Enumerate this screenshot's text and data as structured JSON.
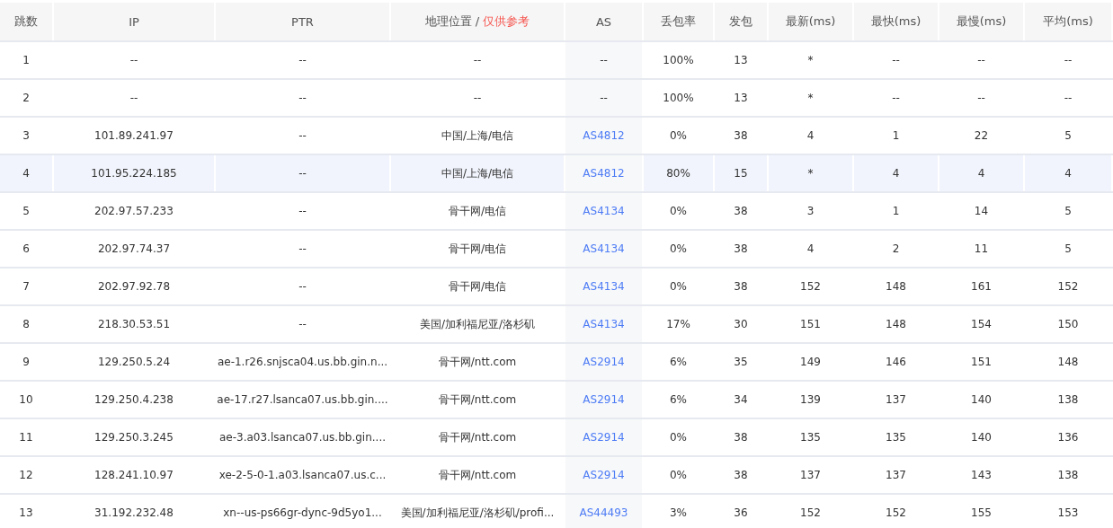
{
  "table": {
    "columns": [
      {
        "label": "跳数"
      },
      {
        "label": "IP"
      },
      {
        "label": "PTR"
      },
      {
        "label": "地理位置 /",
        "note": "仅供参考"
      },
      {
        "label": "AS"
      },
      {
        "label": "丢包率"
      },
      {
        "label": "发包"
      },
      {
        "label": "最新(ms)"
      },
      {
        "label": "最快(ms)"
      },
      {
        "label": "最慢(ms)"
      },
      {
        "label": "平均(ms)"
      }
    ],
    "rows": [
      {
        "selected": false,
        "hop": "1",
        "ip": "--",
        "ptr": "--",
        "geo": "--",
        "as": "--",
        "loss": "100%",
        "sent": "13",
        "last": "*",
        "best": "--",
        "worst": "--",
        "avg": "--"
      },
      {
        "selected": false,
        "hop": "2",
        "ip": "--",
        "ptr": "--",
        "geo": "--",
        "as": "--",
        "loss": "100%",
        "sent": "13",
        "last": "*",
        "best": "--",
        "worst": "--",
        "avg": "--"
      },
      {
        "selected": false,
        "hop": "3",
        "ip": "101.89.241.97",
        "ptr": "--",
        "geo": "中国/上海/电信",
        "as": "AS4812",
        "loss": "0%",
        "sent": "38",
        "last": "4",
        "best": "1",
        "worst": "22",
        "avg": "5"
      },
      {
        "selected": true,
        "hop": "4",
        "ip": "101.95.224.185",
        "ptr": "--",
        "geo": "中国/上海/电信",
        "as": "AS4812",
        "loss": "80%",
        "sent": "15",
        "last": "*",
        "best": "4",
        "worst": "4",
        "avg": "4"
      },
      {
        "selected": false,
        "hop": "5",
        "ip": "202.97.57.233",
        "ptr": "--",
        "geo": "骨干网/电信",
        "as": "AS4134",
        "loss": "0%",
        "sent": "38",
        "last": "3",
        "best": "1",
        "worst": "14",
        "avg": "5"
      },
      {
        "selected": false,
        "hop": "6",
        "ip": "202.97.74.37",
        "ptr": "--",
        "geo": "骨干网/电信",
        "as": "AS4134",
        "loss": "0%",
        "sent": "38",
        "last": "4",
        "best": "2",
        "worst": "11",
        "avg": "5"
      },
      {
        "selected": false,
        "hop": "7",
        "ip": "202.97.92.78",
        "ptr": "--",
        "geo": "骨干网/电信",
        "as": "AS4134",
        "loss": "0%",
        "sent": "38",
        "last": "152",
        "best": "148",
        "worst": "161",
        "avg": "152"
      },
      {
        "selected": false,
        "hop": "8",
        "ip": "218.30.53.51",
        "ptr": "--",
        "geo": "美国/加利福尼亚/洛杉矶",
        "as": "AS4134",
        "loss": "17%",
        "sent": "30",
        "last": "151",
        "best": "148",
        "worst": "154",
        "avg": "150"
      },
      {
        "selected": false,
        "hop": "9",
        "ip": "129.250.5.24",
        "ptr": "ae-1.r26.snjsca04.us.bb.gin.n...",
        "geo": "骨干网/ntt.com",
        "as": "AS2914",
        "loss": "6%",
        "sent": "35",
        "last": "149",
        "best": "146",
        "worst": "151",
        "avg": "148"
      },
      {
        "selected": false,
        "hop": "10",
        "ip": "129.250.4.238",
        "ptr": "ae-17.r27.lsanca07.us.bb.gin....",
        "geo": "骨干网/ntt.com",
        "as": "AS2914",
        "loss": "6%",
        "sent": "34",
        "last": "139",
        "best": "137",
        "worst": "140",
        "avg": "138"
      },
      {
        "selected": false,
        "hop": "11",
        "ip": "129.250.3.245",
        "ptr": "ae-3.a03.lsanca07.us.bb.gin....",
        "geo": "骨干网/ntt.com",
        "as": "AS2914",
        "loss": "0%",
        "sent": "38",
        "last": "135",
        "best": "135",
        "worst": "140",
        "avg": "136"
      },
      {
        "selected": false,
        "hop": "12",
        "ip": "128.241.10.97",
        "ptr": "xe-2-5-0-1.a03.lsanca07.us.c...",
        "geo": "骨干网/ntt.com",
        "as": "AS2914",
        "loss": "0%",
        "sent": "38",
        "last": "137",
        "best": "137",
        "worst": "143",
        "avg": "138"
      },
      {
        "selected": false,
        "hop": "13",
        "ip": "31.192.232.48",
        "ptr": "xn--us-ps66gr-dync-9d5yo1...",
        "geo": "美国/加利福尼亚/洛杉矶/profi...",
        "as": "AS44493",
        "loss": "3%",
        "sent": "36",
        "last": "152",
        "best": "152",
        "worst": "155",
        "avg": "153"
      }
    ]
  }
}
